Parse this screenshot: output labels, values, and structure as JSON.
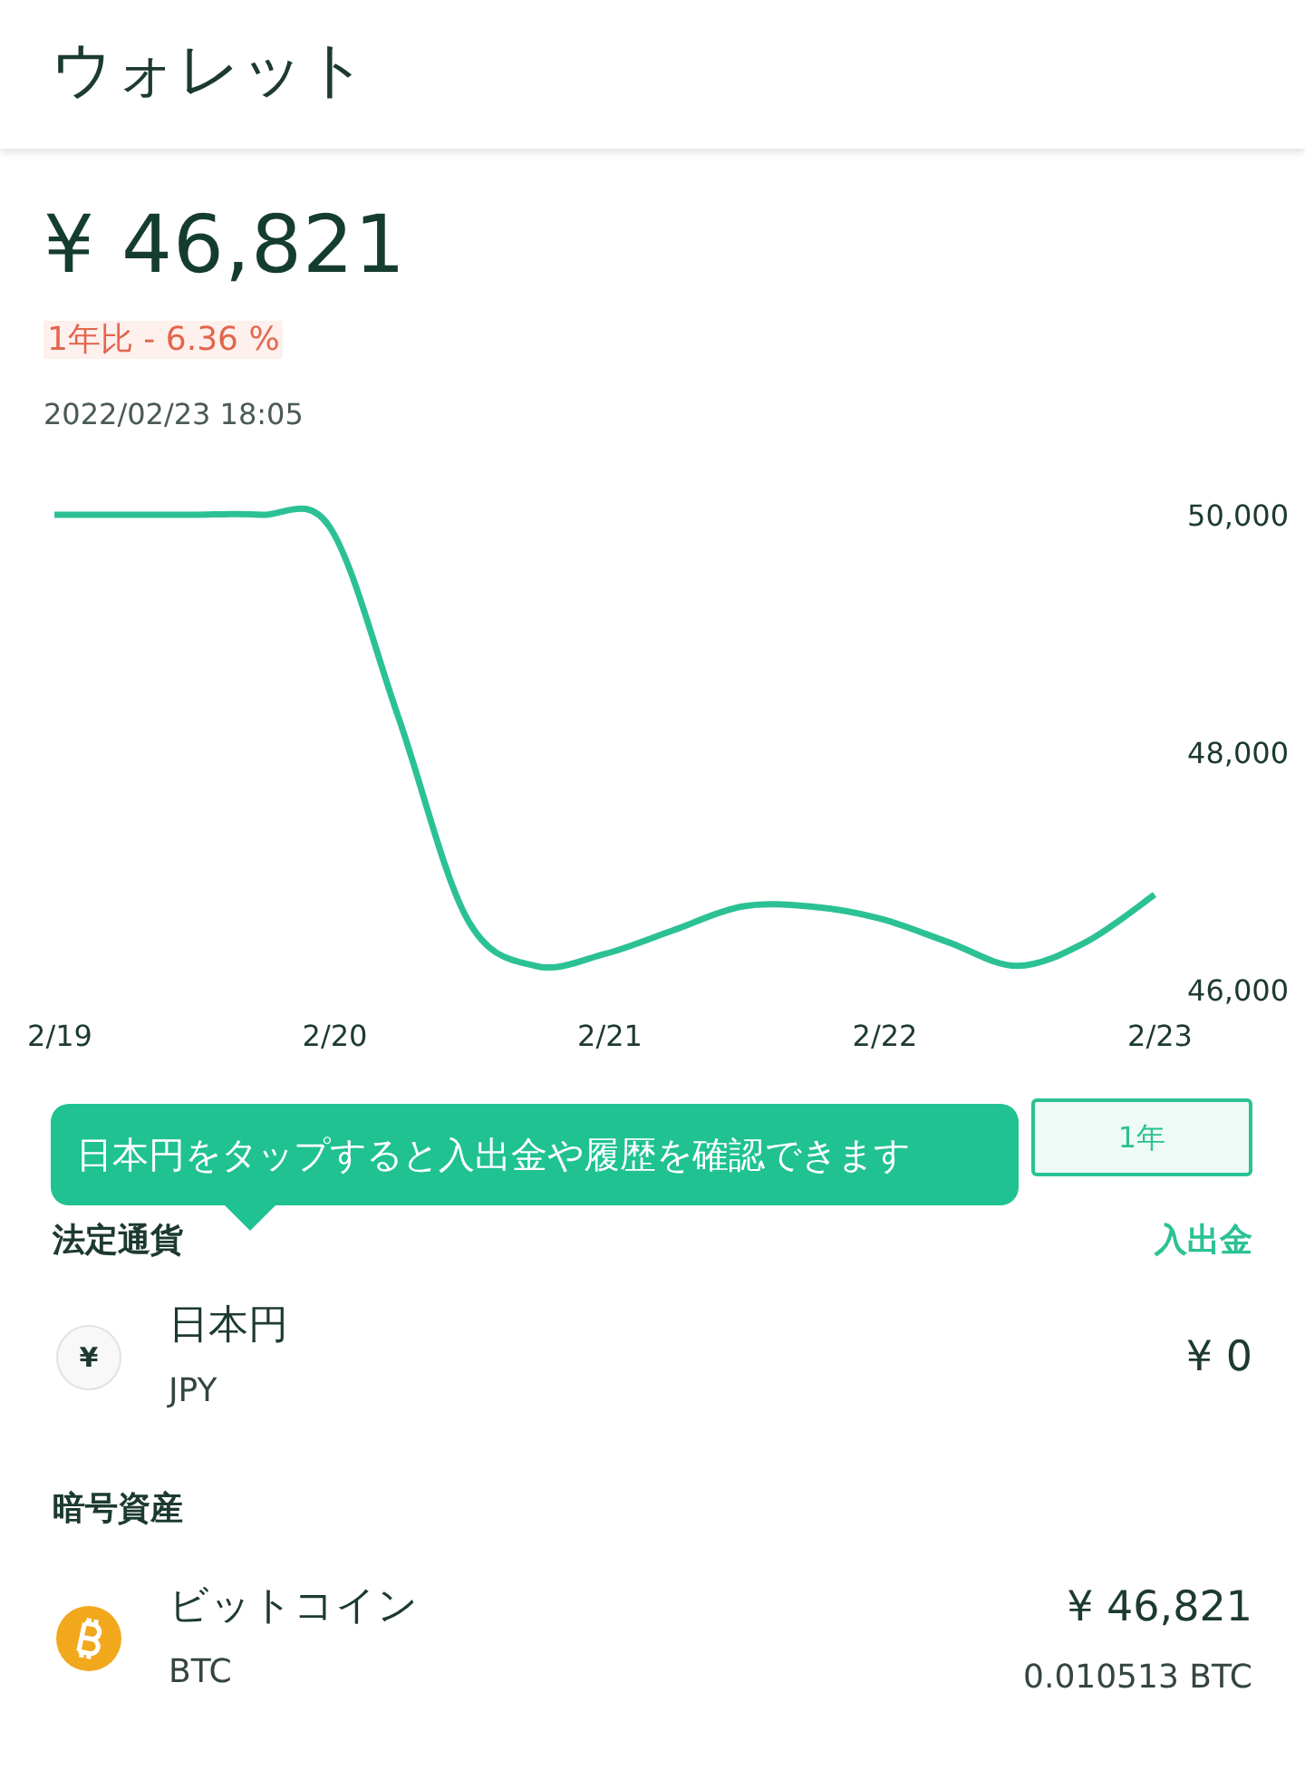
{
  "header": {
    "title": "ウォレット"
  },
  "balance": {
    "amount": "¥ 46,821",
    "change": "1年比 - 6.36 %",
    "timestamp": "2022/02/23 18:05"
  },
  "chart": {
    "chart_data": {
      "type": "line",
      "categories": [
        "2/19",
        null,
        null,
        null,
        "2/20",
        null,
        null,
        null,
        "2/21",
        null,
        null,
        null,
        "2/22",
        null,
        null,
        null,
        "2/23"
      ],
      "series": [
        {
          "color": "#2cc194",
          "values": [
            50000,
            50000,
            50000,
            50000,
            49900,
            48300,
            46600,
            46200,
            46300,
            46500,
            46700,
            46700,
            46600,
            46400,
            46200,
            46400,
            46800
          ]
        }
      ],
      "ylim": [
        46000,
        50000
      ],
      "yticks": [
        {
          "value": 50000,
          "label": "50,000"
        },
        {
          "value": 48000,
          "label": "48,000"
        },
        {
          "value": 46000,
          "label": "46,000"
        }
      ]
    }
  },
  "periods": [
    {
      "label": "1年",
      "selected": true
    }
  ],
  "tooltip": {
    "text": "日本円をタップすると入出金や履歴を確認できます"
  },
  "sections": [
    {
      "title": "法定通貨",
      "action": "入出金",
      "assets": [
        {
          "kind": "fiat",
          "symbol": "¥",
          "name": "日本円",
          "code": "JPY",
          "value": "¥ 0"
        }
      ]
    },
    {
      "title": "暗号資産",
      "assets": [
        {
          "kind": "bitcoin",
          "name": "ビットコイン",
          "code": "BTC",
          "value": "¥ 46,821",
          "amount": "0.010513 BTC"
        }
      ]
    }
  ]
}
